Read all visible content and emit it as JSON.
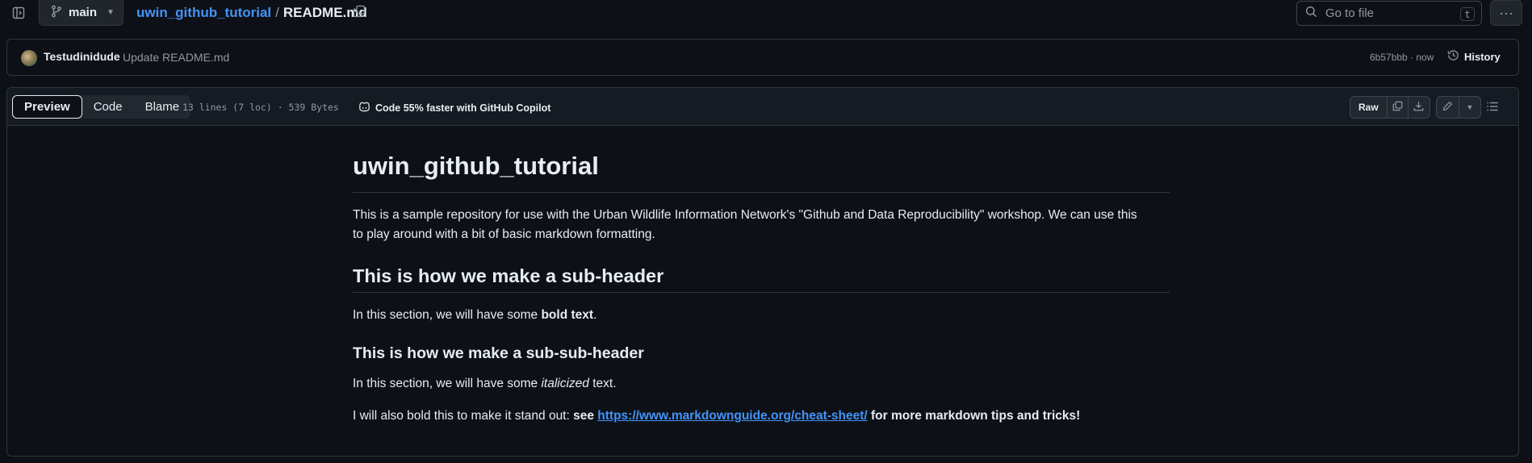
{
  "topbar": {
    "branch": "main",
    "repo": "uwin_github_tutorial",
    "separator": "/",
    "file": "README.md",
    "goto_placeholder": "Go to file",
    "goto_shortcut": "t"
  },
  "commit": {
    "author": "Testudinidude",
    "message": "Update README.md",
    "meta": "6b57bbb · now",
    "history_label": "History"
  },
  "file_header": {
    "tabs": [
      "Preview",
      "Code",
      "Blame"
    ],
    "active_tab": "Preview",
    "info": "13 lines (7 loc) · 539 Bytes",
    "copilot": "Code 55% faster with GitHub Copilot",
    "raw_label": "Raw"
  },
  "readme": {
    "h1": "uwin_github_tutorial",
    "intro_line1": "This is a sample repository for use with the Urban Wildlife Information Network's \"Github and Data Reproducibility\" workshop. We can use this",
    "intro_line2": "to play around with a bit of basic markdown formatting.",
    "h2": "This is how we make a sub-header",
    "section1_prefix": "In this section, we will have some ",
    "section1_bold": "bold text",
    "section1_suffix": ".",
    "h3": "This is how we make a sub-sub-header",
    "section2_prefix": "In this section, we will have some ",
    "section2_italic": "italicized",
    "section2_suffix": " text.",
    "final_prefix": "I will also bold this to make it stand out: ",
    "final_see": "see ",
    "final_link": "https://www.markdownguide.org/cheat-sheet/",
    "final_suffix": " for more markdown tips and tricks!"
  },
  "colors": {
    "background": "#0d1117",
    "link": "#4493f8",
    "border": "#30363d"
  }
}
